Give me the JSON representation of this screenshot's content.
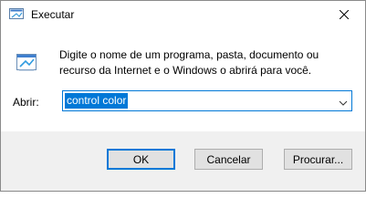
{
  "window": {
    "title": "Executar",
    "app_icon": "run-app-icon",
    "close_icon": "close-icon"
  },
  "dialog": {
    "icon": "run-dialog-icon",
    "description_line1": "Digite o nome de um programa, pasta, documento ou",
    "description_line2": "recurso da Internet e o Windows o abrirá para você.",
    "open_label": "Abrir:",
    "open_value": "control color",
    "dropdown_icon": "chevron-down-icon"
  },
  "buttons": {
    "ok": "OK",
    "cancel": "Cancelar",
    "browse": "Procurar..."
  },
  "colors": {
    "accent": "#0078d7",
    "footer_bg": "#f0f0f0",
    "button_bg": "#e1e1e1"
  }
}
